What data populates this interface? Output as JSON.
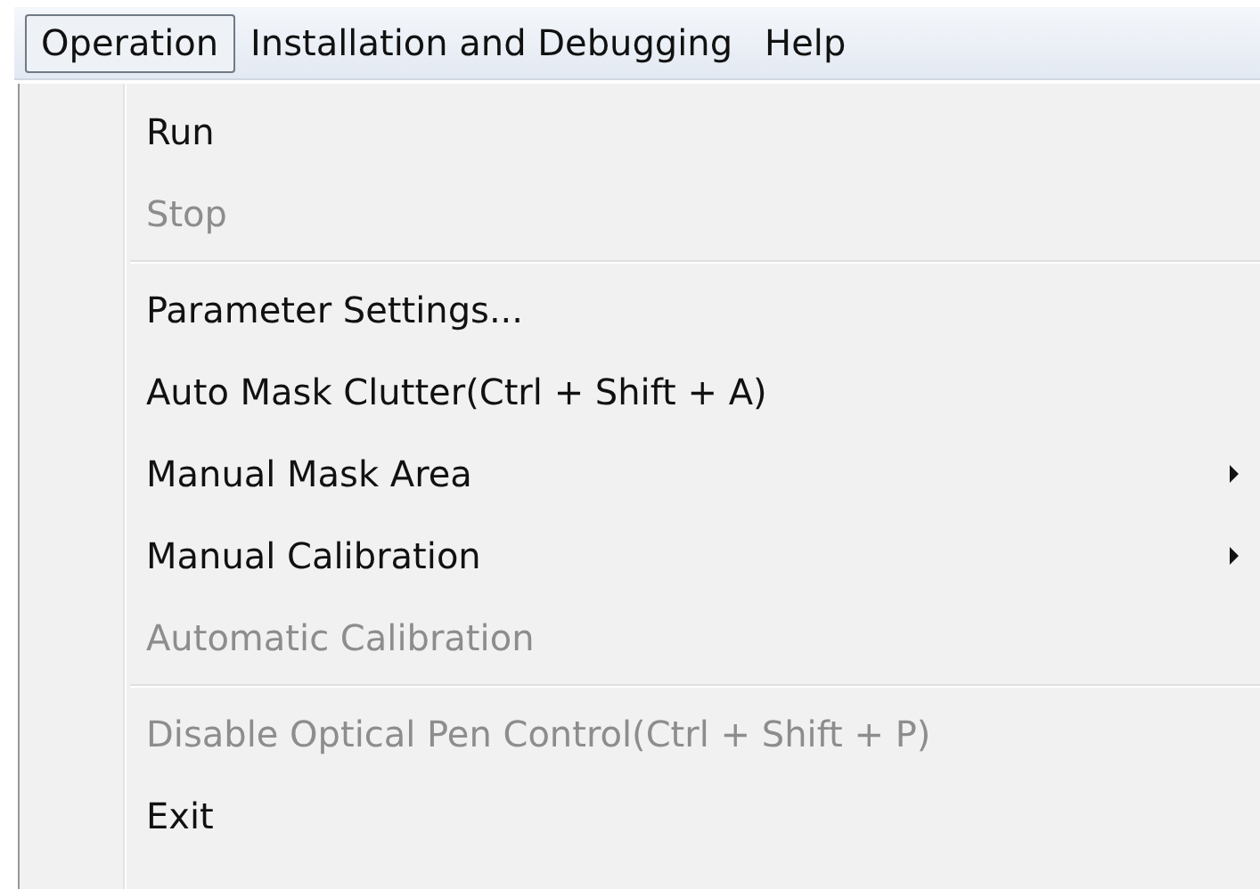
{
  "menu_bar": [
    {
      "label": "Operation",
      "selected": true
    },
    {
      "label": "Installation and Debugging",
      "selected": false
    },
    {
      "label": "Help",
      "selected": false
    }
  ],
  "menu": [
    {
      "kind": "item",
      "label": "Run",
      "disabled": false,
      "submenu": false
    },
    {
      "kind": "item",
      "label": "Stop",
      "disabled": true,
      "submenu": false
    },
    {
      "kind": "separator"
    },
    {
      "kind": "item",
      "label": "Parameter Settings...",
      "disabled": false,
      "submenu": false
    },
    {
      "kind": "item",
      "label": "Auto Mask Clutter(Ctrl + Shift + A)",
      "disabled": false,
      "submenu": false
    },
    {
      "kind": "item",
      "label": "Manual Mask Area",
      "disabled": false,
      "submenu": true
    },
    {
      "kind": "item",
      "label": "Manual Calibration",
      "disabled": false,
      "submenu": true
    },
    {
      "kind": "item",
      "label": "Automatic Calibration",
      "disabled": true,
      "submenu": false
    },
    {
      "kind": "separator"
    },
    {
      "kind": "item",
      "label": "Disable Optical Pen Control(Ctrl + Shift + P)",
      "disabled": true,
      "submenu": false
    },
    {
      "kind": "item",
      "label": "Exit",
      "disabled": false,
      "submenu": false
    }
  ]
}
